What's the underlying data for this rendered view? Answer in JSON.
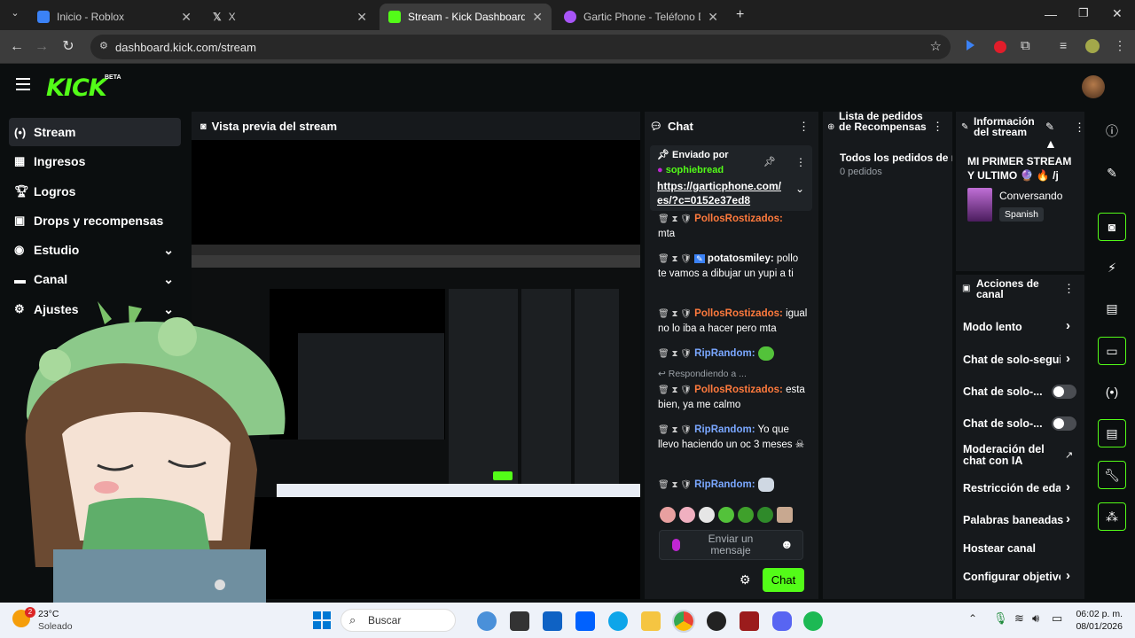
{
  "browser": {
    "tabs": [
      {
        "title": "Inicio - Roblox",
        "color": "#3b82f6"
      },
      {
        "title": "X",
        "color": "#000000"
      },
      {
        "title": "Stream - Kick Dashboard",
        "color": "#53fc18"
      },
      {
        "title": "Gartic Phone - Teléfono Descor",
        "color": "#a855f7"
      }
    ],
    "url": "dashboard.kick.com/stream"
  },
  "header": {
    "logo": "KICK",
    "beta": "BETA"
  },
  "sidebar": {
    "items": [
      {
        "label": "Stream",
        "icon": "stream-icon"
      },
      {
        "label": "Ingresos",
        "icon": "chart-icon"
      },
      {
        "label": "Logros",
        "icon": "trophy-icon"
      },
      {
        "label": "Drops y recompensas",
        "icon": "gift-icon"
      },
      {
        "label": "Estudio",
        "icon": "studio-icon"
      },
      {
        "label": "Canal",
        "icon": "channel-icon"
      },
      {
        "label": "Ajustes",
        "icon": "gear-icon"
      }
    ]
  },
  "preview": {
    "title": "Vista previa del stream"
  },
  "chat": {
    "title": "Chat",
    "pinned": {
      "label": "Enviado por",
      "user": "sophiebread",
      "link": "https://garticphone.com/es/?c=0152e37ed8"
    },
    "messages": [
      {
        "user": "PollosRostizados:",
        "text": "mta",
        "color": "#ff7a3d"
      },
      {
        "user": "potatosmiley:",
        "text": "pollo te vamos a dibujar un yupi a ti",
        "color": "#ffffff"
      },
      {
        "user": "PollosRostizados:",
        "text": "igual no lo iba a hacer pero mta",
        "color": "#ff7a3d"
      },
      {
        "user": "RipRandom:",
        "text": "",
        "color": "#7aa7ff"
      },
      {
        "user": "PollosRostizados:",
        "text": "esta bien, ya me calmo",
        "color": "#ff7a3d",
        "reply": "Respondiendo a ..."
      },
      {
        "user": "RipRandom:",
        "text": "Yo que llevo haciendo un oc 3 meses ☠",
        "color": "#7aa7ff"
      },
      {
        "user": "RipRandom:",
        "text": "",
        "color": "#7aa7ff"
      }
    ],
    "input_placeholder": "Enviar un mensaje",
    "send_label": "Chat"
  },
  "rewards": {
    "title": "Lista de pedidos de Recompensas",
    "all": "Todos los pedidos de r",
    "count": "0 pedidos"
  },
  "info": {
    "title": "Información del stream",
    "stream_title": "MI PRIMER STREAM Y ULTIMO 🔮 🔥 /j",
    "category": "Conversando",
    "language": "Spanish"
  },
  "actions": {
    "title": "Acciones de canal",
    "items": [
      {
        "label": "Modo lento",
        "kind": "chevron"
      },
      {
        "label": "Chat de solo-seguidores",
        "kind": "chevron"
      },
      {
        "label": "Chat de solo-...",
        "kind": "toggle"
      },
      {
        "label": "Chat de solo-...",
        "kind": "toggle"
      },
      {
        "label": "Moderación del chat con IA",
        "kind": "external"
      },
      {
        "label": "Restricción de edad",
        "kind": "chevron"
      },
      {
        "label": "Palabras baneadas",
        "kind": "chevron"
      },
      {
        "label": "Hostear canal",
        "kind": "none"
      },
      {
        "label": "Configurar objetivos",
        "kind": "chevron"
      }
    ]
  },
  "taskbar": {
    "weather_temp": "23°C",
    "weather_text": "Soleado",
    "search": "Buscar",
    "time": "06:02 p. m.",
    "date": "08/01/2026"
  }
}
